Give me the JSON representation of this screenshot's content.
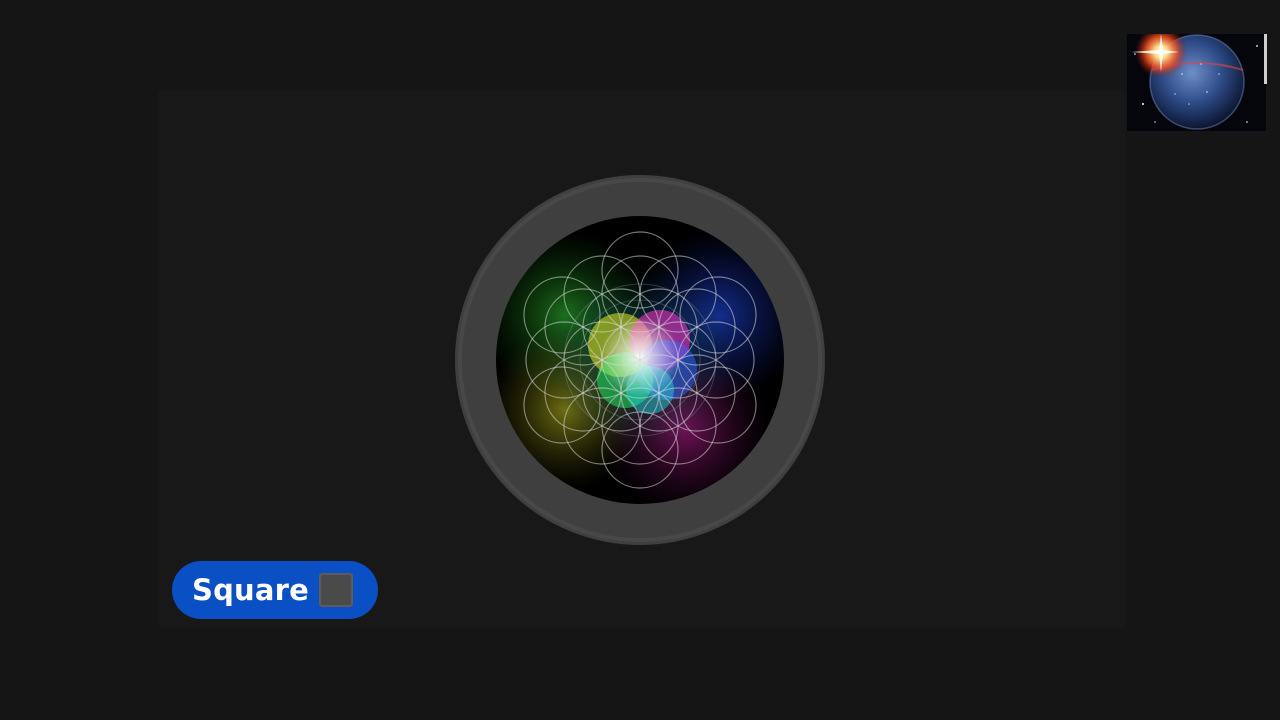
{
  "overlay_label": {
    "text": "Square",
    "icon": "black-square-icon",
    "background_color": "#0a4fc4"
  },
  "thumbnail": {
    "icon": "planet-with-starburst-image"
  },
  "graphic": {
    "icon": "flower-of-life-rainbow-icon"
  }
}
